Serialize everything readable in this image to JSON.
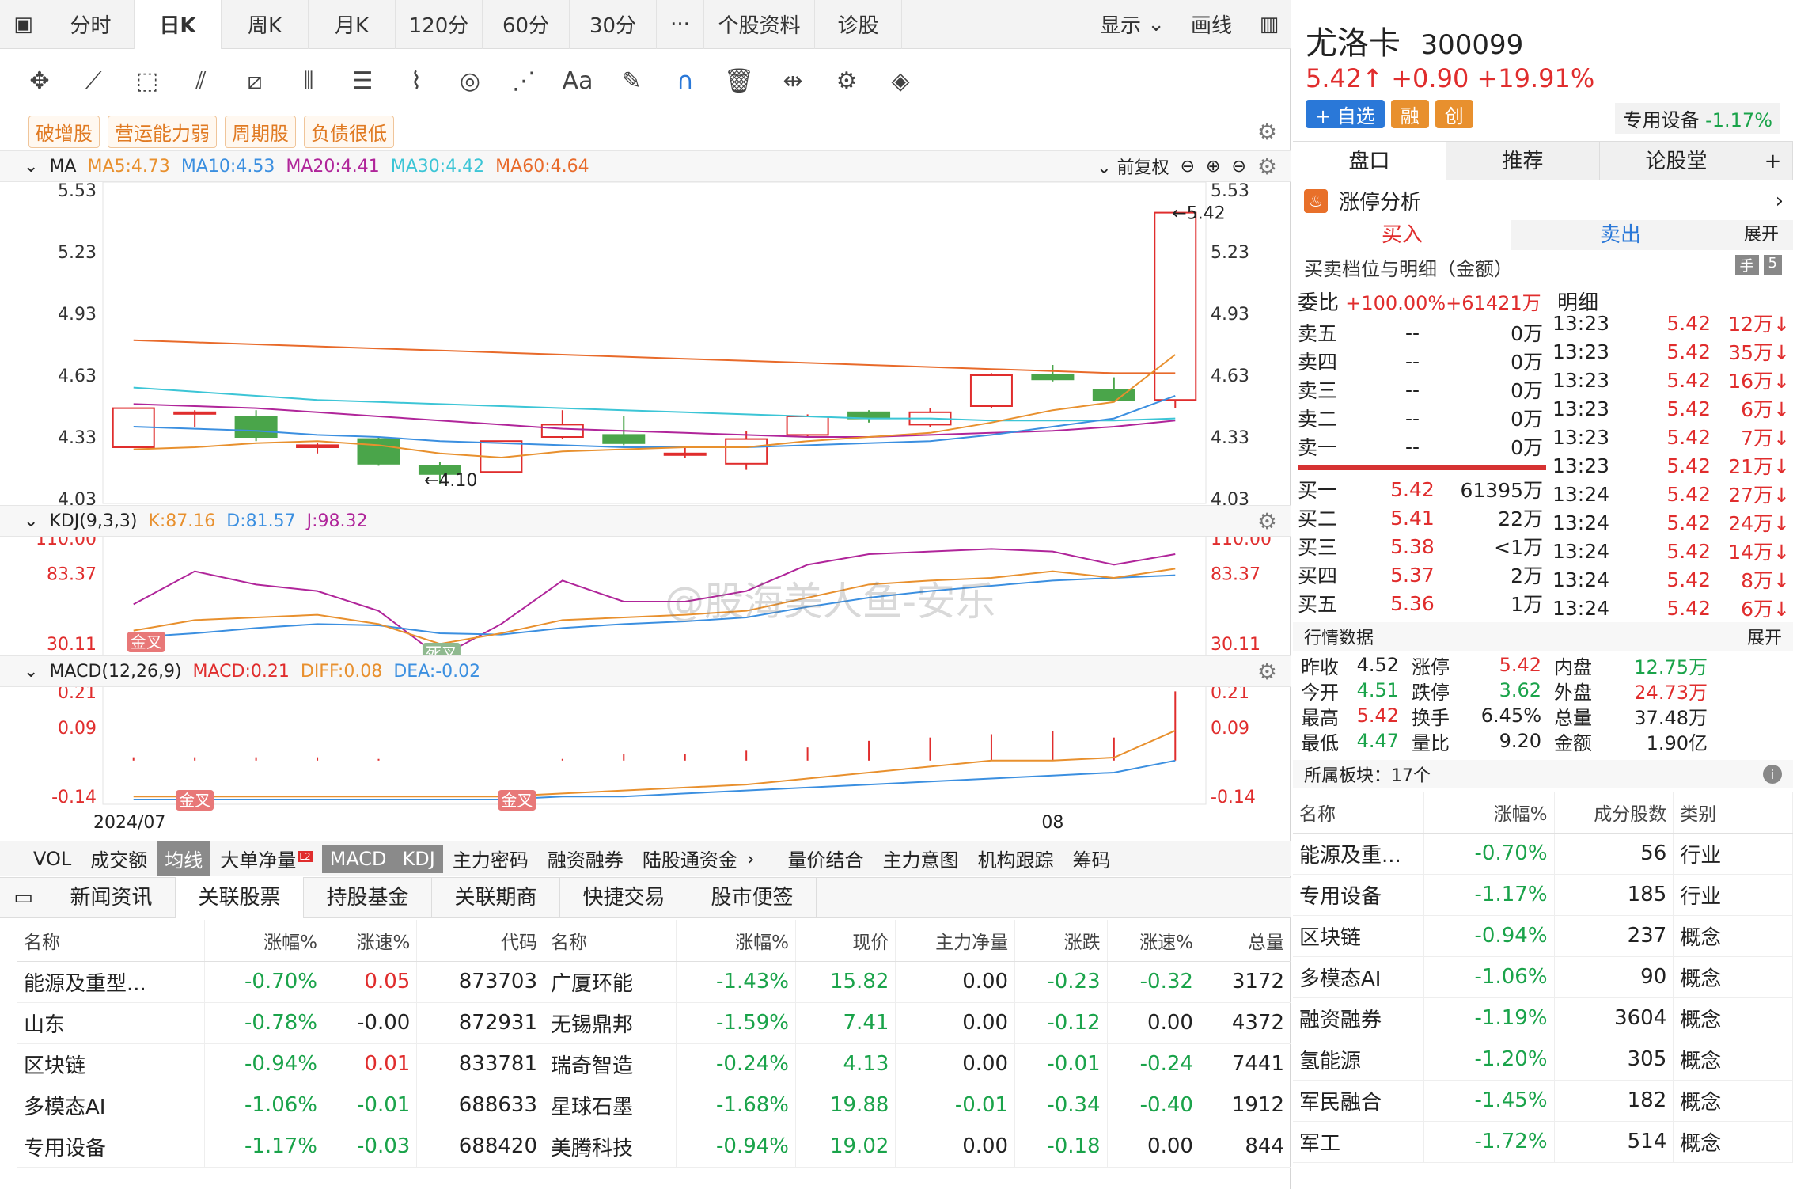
{
  "top_tabs": [
    "分时",
    "日K",
    "周K",
    "月K",
    "120分",
    "60分",
    "30分",
    "···",
    "个股资料",
    "诊股"
  ],
  "top_right": {
    "display": "显示",
    "draw": "画线"
  },
  "tags": [
    "破增股",
    "营运能力弱",
    "周期股",
    "负债很低"
  ],
  "ma_legend": {
    "name": "MA",
    "items": [
      {
        "label": "MA5:4.73",
        "color": "#e8902e"
      },
      {
        "label": "MA10:4.53",
        "color": "#3b8fe0"
      },
      {
        "label": "MA20:4.41",
        "color": "#b0259a"
      },
      {
        "label": "MA30:4.42",
        "color": "#3cc5d6"
      },
      {
        "label": "MA60:4.64",
        "color": "#e86a2a"
      }
    ],
    "adjust": "前复权"
  },
  "kdj_legend": {
    "name": "KDJ(9,3,3)",
    "items": [
      {
        "label": "K:87.16",
        "color": "#e8902e"
      },
      {
        "label": "D:81.57",
        "color": "#3b8fe0"
      },
      {
        "label": "J:98.32",
        "color": "#b0259a"
      }
    ]
  },
  "macd_legend": {
    "name": "MACD(12,26,9)",
    "items": [
      {
        "label": "MACD:0.21",
        "color": "#e02d2d"
      },
      {
        "label": "DIFF:0.08",
        "color": "#e8902e"
      },
      {
        "label": "DEA:-0.02",
        "color": "#3b8fe0"
      }
    ]
  },
  "chart_data": {
    "type": "candlestick",
    "price_axis": [
      "5.53",
      "5.23",
      "4.93",
      "4.63",
      "4.33",
      "4.03"
    ],
    "price_range": [
      4.03,
      5.53
    ],
    "kdj_axis": [
      "110.00",
      "83.37",
      "30.11"
    ],
    "macd_axis": [
      "0.21",
      "0.09",
      "-0.14"
    ],
    "x_labels": [
      "2024/07",
      "08"
    ],
    "max_label": "5.42",
    "min_label": "4.10",
    "candles": [
      {
        "o": 4.28,
        "c": 4.47,
        "h": 4.47,
        "l": 4.28
      },
      {
        "o": 4.45,
        "c": 4.45,
        "h": 4.46,
        "l": 4.38
      },
      {
        "o": 4.43,
        "c": 4.33,
        "h": 4.46,
        "l": 4.31
      },
      {
        "o": 4.28,
        "c": 4.29,
        "h": 4.3,
        "l": 4.25
      },
      {
        "o": 4.32,
        "c": 4.2,
        "h": 4.33,
        "l": 4.19
      },
      {
        "o": 4.19,
        "c": 4.15,
        "h": 4.21,
        "l": 4.1
      },
      {
        "o": 4.16,
        "c": 4.31,
        "h": 4.31,
        "l": 4.16
      },
      {
        "o": 4.33,
        "c": 4.39,
        "h": 4.46,
        "l": 4.32
      },
      {
        "o": 4.34,
        "c": 4.3,
        "h": 4.43,
        "l": 4.29
      },
      {
        "o": 4.25,
        "c": 4.25,
        "h": 4.28,
        "l": 4.23
      },
      {
        "o": 4.2,
        "c": 4.32,
        "h": 4.36,
        "l": 4.17
      },
      {
        "o": 4.34,
        "c": 4.43,
        "h": 4.44,
        "l": 4.33
      },
      {
        "o": 4.45,
        "c": 4.42,
        "h": 4.46,
        "l": 4.4
      },
      {
        "o": 4.39,
        "c": 4.45,
        "h": 4.47,
        "l": 4.38
      },
      {
        "o": 4.48,
        "c": 4.63,
        "h": 4.64,
        "l": 4.47
      },
      {
        "o": 4.63,
        "c": 4.61,
        "h": 4.68,
        "l": 4.6
      },
      {
        "o": 4.56,
        "c": 4.51,
        "h": 4.62,
        "l": 4.5
      },
      {
        "o": 4.51,
        "c": 5.42,
        "h": 5.42,
        "l": 4.47
      }
    ],
    "ma5": [
      4.27,
      4.28,
      4.3,
      4.31,
      4.29,
      4.25,
      4.23,
      4.26,
      4.27,
      4.28,
      4.28,
      4.31,
      4.33,
      4.35,
      4.4,
      4.46,
      4.5,
      4.73
    ],
    "ma10": [
      4.38,
      4.37,
      4.36,
      4.34,
      4.33,
      4.31,
      4.3,
      4.29,
      4.28,
      4.28,
      4.28,
      4.29,
      4.3,
      4.31,
      4.34,
      4.38,
      4.42,
      4.53
    ],
    "ma20": [
      4.49,
      4.48,
      4.47,
      4.45,
      4.43,
      4.41,
      4.39,
      4.37,
      4.36,
      4.35,
      4.34,
      4.33,
      4.33,
      4.34,
      4.35,
      4.36,
      4.38,
      4.41
    ],
    "ma30": [
      4.57,
      4.55,
      4.53,
      4.51,
      4.5,
      4.49,
      4.48,
      4.47,
      4.46,
      4.45,
      4.44,
      4.43,
      4.42,
      4.42,
      4.41,
      4.41,
      4.41,
      4.42
    ],
    "ma60": [
      4.8,
      4.79,
      4.78,
      4.77,
      4.76,
      4.75,
      4.74,
      4.73,
      4.72,
      4.71,
      4.7,
      4.69,
      4.68,
      4.67,
      4.66,
      4.65,
      4.64,
      4.64
    ],
    "kdj_k": [
      40,
      48,
      50,
      52,
      45,
      30,
      38,
      48,
      50,
      52,
      55,
      65,
      75,
      78,
      80,
      85,
      80,
      87
    ],
    "kdj_d": [
      35,
      38,
      42,
      45,
      44,
      38,
      37,
      42,
      45,
      47,
      50,
      58,
      65,
      70,
      74,
      78,
      80,
      82
    ],
    "kdj_j": [
      60,
      85,
      75,
      70,
      55,
      20,
      45,
      78,
      62,
      62,
      70,
      90,
      98,
      100,
      102,
      100,
      90,
      98
    ],
    "macd_bar": [
      0.01,
      0.01,
      0.01,
      0.01,
      0.005,
      0.0,
      0.0,
      0.005,
      0.02,
      0.02,
      0.03,
      0.04,
      0.06,
      0.07,
      0.08,
      0.09,
      0.07,
      0.21
    ],
    "diff": [
      -0.14,
      -0.14,
      -0.14,
      -0.14,
      -0.14,
      -0.14,
      -0.14,
      -0.13,
      -0.12,
      -0.11,
      -0.1,
      -0.08,
      -0.06,
      -0.04,
      -0.02,
      -0.02,
      -0.01,
      0.08
    ],
    "dea": [
      -0.15,
      -0.15,
      -0.15,
      -0.15,
      -0.15,
      -0.15,
      -0.15,
      -0.14,
      -0.14,
      -0.13,
      -0.12,
      -0.11,
      -0.1,
      -0.09,
      -0.08,
      -0.07,
      -0.06,
      -0.02
    ],
    "cross_labels": [
      "金叉",
      "死叉",
      "金叉",
      "金叉"
    ]
  },
  "sub_tabs": [
    "VOL",
    "成交额",
    "均线",
    "大单净量",
    "MACD",
    "KDJ",
    "主力密码",
    "融资融券",
    "陆股通资金",
    "量价结合",
    "主力意图",
    "机构跟踪",
    "筹码"
  ],
  "l2_badge": "L2",
  "watermark": "@股海美人鱼-安乐",
  "news_tabs": [
    "新闻资讯",
    "关联股票",
    "持股基金",
    "关联期商",
    "快捷交易",
    "股市便签"
  ],
  "bottom_table": {
    "headers": [
      "名称",
      "涨幅%",
      "涨速%",
      "代码",
      "名称",
      "涨幅%",
      "现价",
      "主力净量",
      "涨跌",
      "涨速%",
      "总量"
    ],
    "rows": [
      [
        "能源及重型...",
        "-0.70%",
        "0.05",
        "873703",
        "广厦环能",
        "-1.43%",
        "15.82",
        "0.00",
        "-0.23",
        "-0.32",
        "3172"
      ],
      [
        "山东",
        "-0.78%",
        "-0.00",
        "872931",
        "无锡鼎邦",
        "-1.59%",
        "7.41",
        "0.00",
        "-0.12",
        "0.00",
        "4372"
      ],
      [
        "区块链",
        "-0.94%",
        "0.01",
        "833781",
        "瑞奇智造",
        "-0.24%",
        "4.13",
        "0.00",
        "-0.01",
        "-0.24",
        "7441"
      ],
      [
        "多模态AI",
        "-1.06%",
        "-0.01",
        "688633",
        "星球石墨",
        "-1.68%",
        "19.88",
        "-0.01",
        "-0.34",
        "-0.40",
        "1912"
      ],
      [
        "专用设备",
        "-1.17%",
        "-0.03",
        "688420",
        "美腾科技",
        "-0.94%",
        "19.02",
        "0.00",
        "-0.18",
        "0.00",
        "844"
      ]
    ]
  },
  "stock": {
    "name": "尤洛卡",
    "code": "300099",
    "price": "5.42↑",
    "change": "+0.90",
    "pct": "+19.91%",
    "add": "+ 自选",
    "rong": "融",
    "chuang": "创",
    "sector": "专用设备",
    "sector_pct": "-1.17%"
  },
  "right_tabs": [
    "盘口",
    "推荐",
    "论股堂",
    "+"
  ],
  "zt": "涨停分析",
  "buy_label": "买入",
  "sell_label": "卖出",
  "expand": "展开",
  "detail_title": "买卖档位与明细（金额）",
  "wb": {
    "label": "委比",
    "value": "+100.00%+61421万",
    "detail": "明细"
  },
  "asks": [
    [
      "卖五",
      "--",
      "0万"
    ],
    [
      "卖四",
      "--",
      "0万"
    ],
    [
      "卖三",
      "--",
      "0万"
    ],
    [
      "卖二",
      "--",
      "0万"
    ],
    [
      "卖一",
      "--",
      "0万"
    ]
  ],
  "bids": [
    [
      "买一",
      "5.42",
      "61395万"
    ],
    [
      "买二",
      "5.41",
      "22万"
    ],
    [
      "买三",
      "5.38",
      "<1万"
    ],
    [
      "买四",
      "5.37",
      "2万"
    ],
    [
      "买五",
      "5.36",
      "1万"
    ]
  ],
  "ticks": [
    [
      "13:23",
      "5.42",
      "12万↓"
    ],
    [
      "13:23",
      "5.42",
      "35万↓"
    ],
    [
      "13:23",
      "5.42",
      "16万↓"
    ],
    [
      "13:23",
      "5.42",
      "6万↓"
    ],
    [
      "13:23",
      "5.42",
      "7万↓"
    ],
    [
      "13:23",
      "5.42",
      "21万↓"
    ],
    [
      "13:24",
      "5.42",
      "27万↓"
    ],
    [
      "13:24",
      "5.42",
      "24万↓"
    ],
    [
      "13:24",
      "5.42",
      "14万↓"
    ],
    [
      "13:24",
      "5.42",
      "8万↓"
    ],
    [
      "13:24",
      "5.42",
      "6万↓"
    ]
  ],
  "quote_title": "行情数据",
  "quote": [
    [
      "昨收",
      "4.52",
      "涨停",
      "5.42",
      "内盘",
      "12.75万"
    ],
    [
      "今开",
      "4.51",
      "跌停",
      "3.62",
      "外盘",
      "24.73万"
    ],
    [
      "最高",
      "5.42",
      "换手",
      "6.45%",
      "总量",
      "37.48万"
    ],
    [
      "最低",
      "4.47",
      "量比",
      "9.20",
      "金额",
      "1.90亿"
    ]
  ],
  "sector_count": "所属板块：17个",
  "sector_table": {
    "headers": [
      "名称",
      "涨幅%",
      "成分股数",
      "类别"
    ],
    "rows": [
      [
        "能源及重...",
        "-0.70%",
        "56",
        "行业"
      ],
      [
        "专用设备",
        "-1.17%",
        "185",
        "行业"
      ],
      [
        "区块链",
        "-0.94%",
        "237",
        "概念"
      ],
      [
        "多模态AI",
        "-1.06%",
        "90",
        "概念"
      ],
      [
        "融资融券",
        "-1.19%",
        "3604",
        "概念"
      ],
      [
        "氢能源",
        "-1.20%",
        "305",
        "概念"
      ],
      [
        "军民融合",
        "-1.45%",
        "182",
        "概念"
      ],
      [
        "军工",
        "-1.72%",
        "514",
        "概念"
      ]
    ]
  }
}
